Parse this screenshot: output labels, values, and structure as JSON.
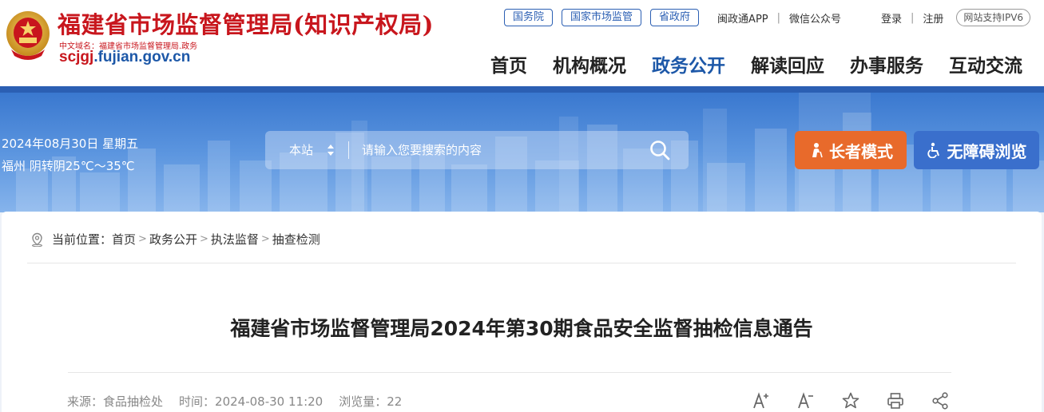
{
  "header": {
    "site_title": "福建省市场监督管理局(知识产权局)",
    "cn_domain": "中文域名：福建省市场监督管理局.政务",
    "domain_prefix": "scjgj",
    "domain_suffix": ".fujian.gov.cn",
    "top_links": [
      "国务院",
      "国家市场监管",
      "省政府"
    ],
    "app_link": "闽政通APP",
    "wechat_link": "微信公众号",
    "login": "登录",
    "register": "注册",
    "ipv6": "网站支持IPV6",
    "nav": [
      "首页",
      "机构概况",
      "政务公开",
      "解读回应",
      "办事服务",
      "互动交流"
    ],
    "nav_active_index": 2
  },
  "banner": {
    "date": "2024年08月30日 星期五",
    "weather": "福州 阴转阴25℃～35℃",
    "search_scope": "本站",
    "search_placeholder": "请输入您要搜索的内容",
    "elder_mode": "长者模式",
    "accessible": "无障碍浏览"
  },
  "breadcrumb": {
    "label": "当前位置：",
    "items": [
      "首页",
      "政务公开",
      "执法监督",
      "抽查检测"
    ]
  },
  "article": {
    "title": "福建省市场监督管理局2024年第30期食品安全监督抽检信息通告",
    "source_label": "来源：",
    "source": "食品抽检处",
    "time_label": "时间：",
    "time": "2024-08-30 11:20",
    "views_label": "浏览量：",
    "views": "22"
  },
  "colors": {
    "brand_red": "#c8161d",
    "brand_blue": "#1d58a8",
    "elder_orange": "#e86a2b",
    "access_blue": "#3a6fcc"
  },
  "icons": [
    "national-emblem-icon",
    "search-icon",
    "elder-icon",
    "wheelchair-icon",
    "location-icon",
    "font-larger-icon",
    "font-smaller-icon",
    "star-icon",
    "print-icon",
    "share-icon"
  ]
}
